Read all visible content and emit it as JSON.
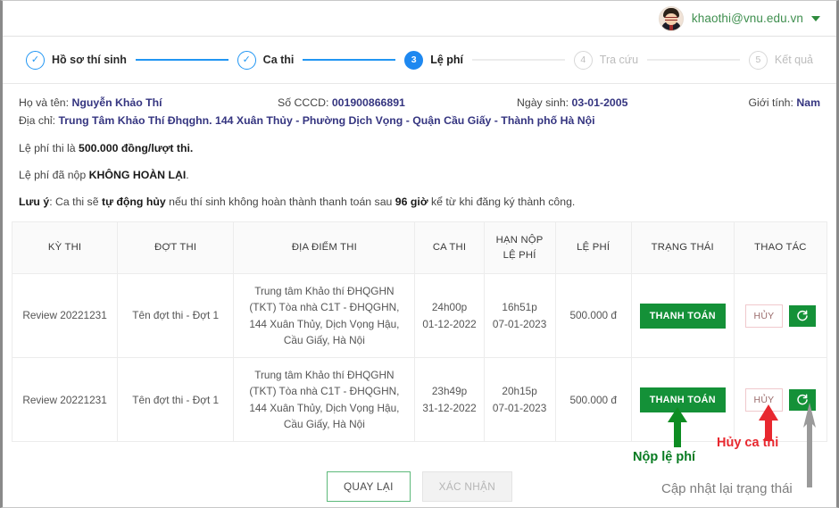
{
  "header": {
    "account_email": "khaothi@vnu.edu.vn",
    "avatar_name": "user-avatar",
    "caret_icon": "chevron-down-icon"
  },
  "stepper": {
    "steps": [
      {
        "num": "1",
        "label": "Hồ sơ thí sinh",
        "state": "done",
        "mark": "✓"
      },
      {
        "num": "2",
        "label": "Ca thi",
        "state": "done",
        "mark": "✓"
      },
      {
        "num": "3",
        "label": "Lệ phí",
        "state": "active",
        "mark": "3"
      },
      {
        "num": "4",
        "label": "Tra cứu",
        "state": "todo",
        "mark": "4"
      },
      {
        "num": "5",
        "label": "Kết quả",
        "state": "todo",
        "mark": "5"
      }
    ]
  },
  "candidate": {
    "name_label": "Họ và tên:",
    "name_value": "Nguyễn Khảo Thí",
    "cccd_label": "Số CCCD:",
    "cccd_value": "001900866891",
    "dob_label": "Ngày sinh:",
    "dob_value": "03-01-2005",
    "gender_label": "Giới tính:",
    "gender_value": "Nam",
    "address_label": "Địa chỉ:",
    "address_value": "Trung Tâm Khảo Thí Đhqghn. 144 Xuân Thủy - Phường Dịch Vọng - Quận Cầu Giấy - Thành phố Hà Nội"
  },
  "notes": {
    "line1_pre": "Lệ phí thi là ",
    "line1_bold": "500.000 đồng/lượt thi.",
    "line2_pre": "Lệ phí đã nộp ",
    "line2_bold": "KHÔNG HOÀN LẠI",
    "line2_post": ".",
    "line3_bold1": "Lưu ý",
    "line3_a": ": Ca thi sẽ ",
    "line3_bold2": "tự động hủy",
    "line3_b": " nếu thí sinh không hoàn thành thanh toán sau ",
    "line3_bold3": "96 giờ",
    "line3_c": " kể từ khi đăng ký thành công."
  },
  "table": {
    "headers": {
      "ky_thi": "KỲ THI",
      "dot_thi": "ĐỢT THI",
      "dia_diem": "ĐỊA ĐIỂM THI",
      "ca_thi": "CA THI",
      "han_nop_l1": "HẠN NỘP",
      "han_nop_l2": "LỆ PHÍ",
      "le_phi": "LỆ PHÍ",
      "trang_thai": "TRẠNG THÁI",
      "thao_tac": "THAO TÁC"
    },
    "rows": [
      {
        "ky_thi": "Review 20221231",
        "dot_thi": "Tên đợt thi - Đợt 1",
        "dia_diem": "Trung tâm Khảo thí ĐHQGHN (TKT) Tòa nhà C1T - ĐHQGHN, 144 Xuân Thủy, Dịch Vọng Hậu, Cầu Giấy, Hà Nội",
        "ca_thi_time": "24h00p",
        "ca_thi_date": "01-12-2022",
        "han_nop_time": "16h51p",
        "han_nop_date": "07-01-2023",
        "le_phi": "500.000 đ",
        "trang_thai_button": "THANH TOÁN",
        "cancel_button": "HỦY",
        "refresh_icon": "refresh-icon"
      },
      {
        "ky_thi": "Review 20221231",
        "dot_thi": "Tên đợt thi - Đợt 1",
        "dia_diem": "Trung tâm Khảo thí ĐHQGHN (TKT) Tòa nhà C1T - ĐHQGHN, 144 Xuân Thủy, Dịch Vọng Hậu, Cầu Giấy, Hà Nội",
        "ca_thi_time": "23h49p",
        "ca_thi_date": "31-12-2022",
        "han_nop_time": "20h15p",
        "han_nop_date": "07-01-2023",
        "le_phi": "500.000 đ",
        "trang_thai_button": "THANH TOÁN",
        "cancel_button": "HỦY",
        "refresh_icon": "refresh-icon"
      }
    ]
  },
  "footer": {
    "back_button": "QUAY LẠI",
    "confirm_button": "XÁC NHẬN"
  },
  "annotations": {
    "pay_text": "Nộp lệ phí",
    "pay_color": "#067a20",
    "cancel_text": "Hủy ca thi",
    "cancel_color": "#e8282f",
    "refresh_text": "Cập nhật lại trạng thái",
    "refresh_color": "#7e7e7e"
  },
  "colors": {
    "accent_green": "#149138",
    "accent_blue": "#1e88f0",
    "value_blue": "#353580",
    "border_gray": "#ececec"
  }
}
